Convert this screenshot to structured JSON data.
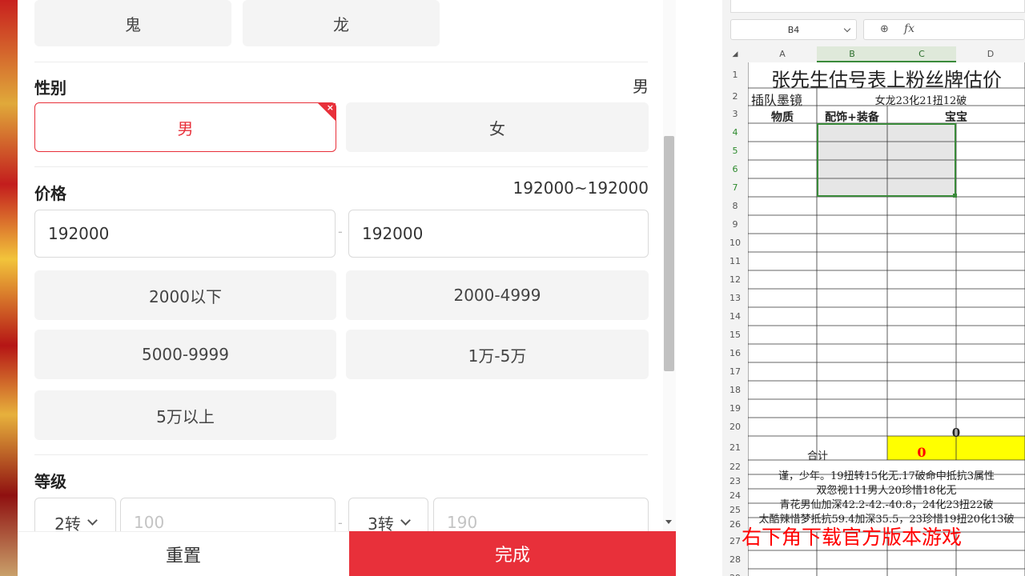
{
  "panel": {
    "race_options": [
      "鬼",
      "龙"
    ],
    "gender": {
      "title": "性别",
      "value": "男",
      "options": [
        "男",
        "女"
      ]
    },
    "price": {
      "title": "价格",
      "value": "192000~192000",
      "min": "192000",
      "max": "192000",
      "dash": "-",
      "ranges": [
        "2000以下",
        "2000-4999",
        "5000-9999",
        "1万-5万",
        "5万以上"
      ]
    },
    "level": {
      "title": "等级",
      "from_select": "2转",
      "from_placeholder": "100",
      "to_select": "3转",
      "to_placeholder": "190",
      "dash": "-"
    },
    "reset_label": "重置",
    "done_label": "完成",
    "accent": "#e8303a"
  },
  "sheet": {
    "name_box": "B4",
    "fx": "fx",
    "columns": [
      "A",
      "B",
      "C",
      "D"
    ],
    "title": "张先生估号表上粉丝牌估价",
    "r2_a": "插队墨镜",
    "r2_bc": "女龙23化21扭12破",
    "r3_a": "物质",
    "r3_b": "配饰+装备",
    "r3_c": "宝宝",
    "r20_c": "0",
    "r21_label": "合计",
    "r21_value": "0",
    "notes": [
      "谨，少年。19扭转15化无.17破命中抵抗3属性",
      "双忽视111男人20珍惜18化无",
      "青花男仙加深42.2-42.-40.8，24化23扭22破",
      "太酷辣惜梦抵抗59.4加深35.5，23珍惜19扭20化13破"
    ],
    "overlay_text": "右下角下载官方版本游戏",
    "highlight_color": "#ffff00",
    "total_color": "#ff0000",
    "overlay_color": "#ff0000"
  }
}
